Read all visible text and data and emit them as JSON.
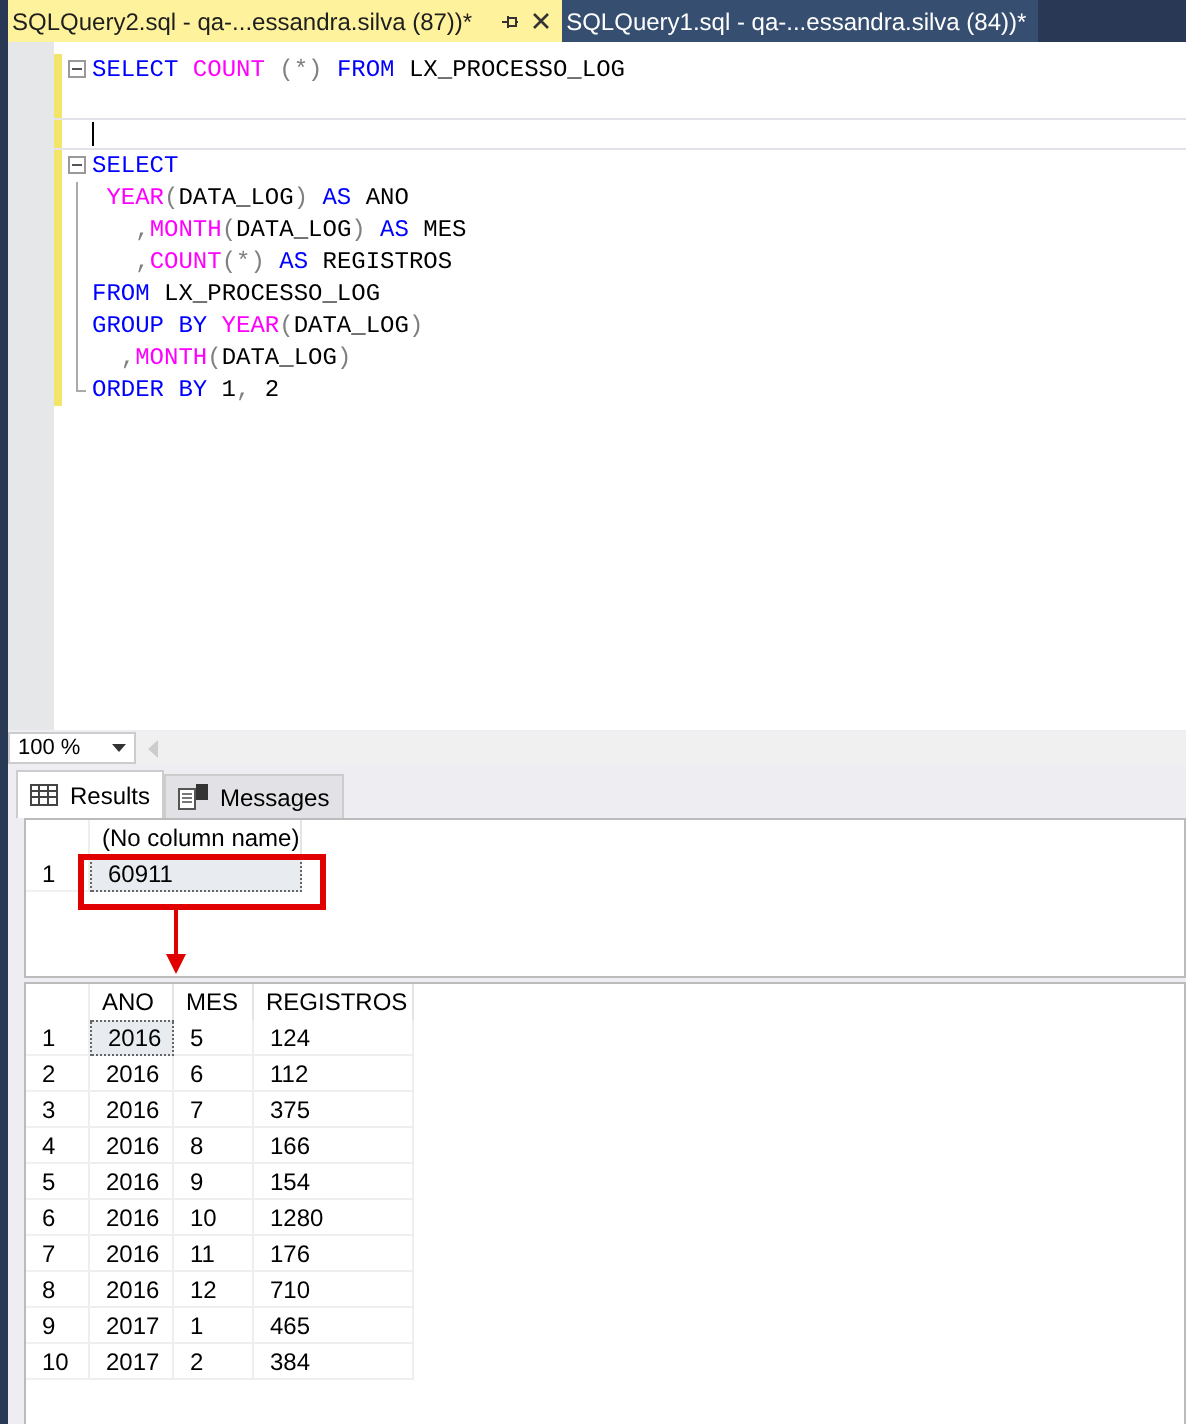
{
  "tabs": [
    {
      "label": "SQLQuery2.sql - qa-...essandra.silva (87))*",
      "selected": true
    },
    {
      "label": "SQLQuery1.sql - qa-...essandra.silva (84))*",
      "selected": false
    }
  ],
  "editor": {
    "lines": [
      {
        "kind": "fold-start",
        "changed": true,
        "current": false,
        "tokens": [
          {
            "t": "SELECT",
            "kind": "keyword"
          },
          {
            "t": " COUNT",
            "kind": "function"
          },
          {
            "t": " (*)",
            "kind": "operator"
          },
          {
            "t": " FROM",
            "kind": "keyword"
          },
          {
            "t": " LX_PROCESSO_LOG",
            "kind": "plain"
          }
        ]
      },
      {
        "kind": "plain",
        "changed": true,
        "current": false
      },
      {
        "kind": "plain",
        "changed": true,
        "current": true
      },
      {
        "kind": "fold-start",
        "changed": true,
        "current": false,
        "tokens": [
          {
            "t": "SELECT",
            "kind": "keyword"
          }
        ]
      },
      {
        "kind": "fold-line",
        "changed": true,
        "current": false,
        "tokens": [
          {
            "t": " YEAR",
            "kind": "function"
          },
          {
            "t": "(",
            "kind": "operator"
          },
          {
            "t": "DATA_LOG",
            "kind": "plain"
          },
          {
            "t": ")",
            "kind": "operator"
          },
          {
            "t": " AS",
            "kind": "keyword"
          },
          {
            "t": " ANO",
            "kind": "plain"
          }
        ]
      },
      {
        "kind": "fold-line",
        "changed": true,
        "current": false,
        "tokens": [
          {
            "t": "   ,",
            "kind": "operator"
          },
          {
            "t": "MONTH",
            "kind": "function"
          },
          {
            "t": "(",
            "kind": "operator"
          },
          {
            "t": "DATA_LOG",
            "kind": "plain"
          },
          {
            "t": ")",
            "kind": "operator"
          },
          {
            "t": " AS",
            "kind": "keyword"
          },
          {
            "t": " MES",
            "kind": "plain"
          }
        ]
      },
      {
        "kind": "fold-line",
        "changed": true,
        "current": false,
        "tokens": [
          {
            "t": "   ,",
            "kind": "operator"
          },
          {
            "t": "COUNT",
            "kind": "function"
          },
          {
            "t": "(*)",
            "kind": "operator"
          },
          {
            "t": " AS",
            "kind": "keyword"
          },
          {
            "t": " REGISTROS",
            "kind": "plain"
          }
        ]
      },
      {
        "kind": "fold-line",
        "changed": true,
        "current": false,
        "tokens": [
          {
            "t": "FROM",
            "kind": "keyword"
          },
          {
            "t": " LX_PROCESSO_LOG",
            "kind": "plain"
          }
        ]
      },
      {
        "kind": "fold-line",
        "changed": true,
        "current": false,
        "tokens": [
          {
            "t": "GROUP BY",
            "kind": "keyword"
          },
          {
            "t": " YEAR",
            "kind": "function"
          },
          {
            "t": "(",
            "kind": "operator"
          },
          {
            "t": "DATA_LOG",
            "kind": "plain"
          },
          {
            "t": ")",
            "kind": "operator"
          }
        ]
      },
      {
        "kind": "fold-line",
        "changed": true,
        "current": false,
        "tokens": [
          {
            "t": "  ,",
            "kind": "operator"
          },
          {
            "t": "MONTH",
            "kind": "function"
          },
          {
            "t": "(",
            "kind": "operator"
          },
          {
            "t": "DATA_LOG",
            "kind": "plain"
          },
          {
            "t": ")",
            "kind": "operator"
          }
        ]
      },
      {
        "kind": "fold-end",
        "changed": true,
        "current": false,
        "tokens": [
          {
            "t": "ORDER BY",
            "kind": "keyword"
          },
          {
            "t": " 1",
            "kind": "plain"
          },
          {
            "t": ",",
            "kind": "operator"
          },
          {
            "t": " 2",
            "kind": "plain"
          }
        ]
      }
    ]
  },
  "zoom": {
    "value": "100 %"
  },
  "result_tabs": [
    {
      "label": "Results",
      "kind": "grid",
      "selected": true
    },
    {
      "label": "Messages",
      "kind": "messages",
      "selected": false
    }
  ],
  "grids": [
    {
      "callout": true,
      "columns": [
        "(No column name)"
      ],
      "rows": [
        {
          "number": "1",
          "focused": true,
          "cells": [
            "60911"
          ]
        }
      ]
    },
    {
      "callout": false,
      "columns": [
        "ANO",
        "MES",
        "REGISTROS"
      ],
      "rows": [
        {
          "number": "1",
          "focused": true,
          "cells": [
            "2016",
            "5",
            "124"
          ]
        },
        {
          "number": "2",
          "focused": false,
          "cells": [
            "2016",
            "6",
            "112"
          ]
        },
        {
          "number": "3",
          "focused": false,
          "cells": [
            "2016",
            "7",
            "375"
          ]
        },
        {
          "number": "4",
          "focused": false,
          "cells": [
            "2016",
            "8",
            "166"
          ]
        },
        {
          "number": "5",
          "focused": false,
          "cells": [
            "2016",
            "9",
            "154"
          ]
        },
        {
          "number": "6",
          "focused": false,
          "cells": [
            "2016",
            "10",
            "1280"
          ]
        },
        {
          "number": "7",
          "focused": false,
          "cells": [
            "2016",
            "11",
            "176"
          ]
        },
        {
          "number": "8",
          "focused": false,
          "cells": [
            "2016",
            "12",
            "710"
          ]
        },
        {
          "number": "9",
          "focused": false,
          "cells": [
            "2017",
            "1",
            "465"
          ]
        },
        {
          "number": "10",
          "focused": false,
          "cells": [
            "2017",
            "2",
            "384"
          ]
        }
      ]
    }
  ]
}
